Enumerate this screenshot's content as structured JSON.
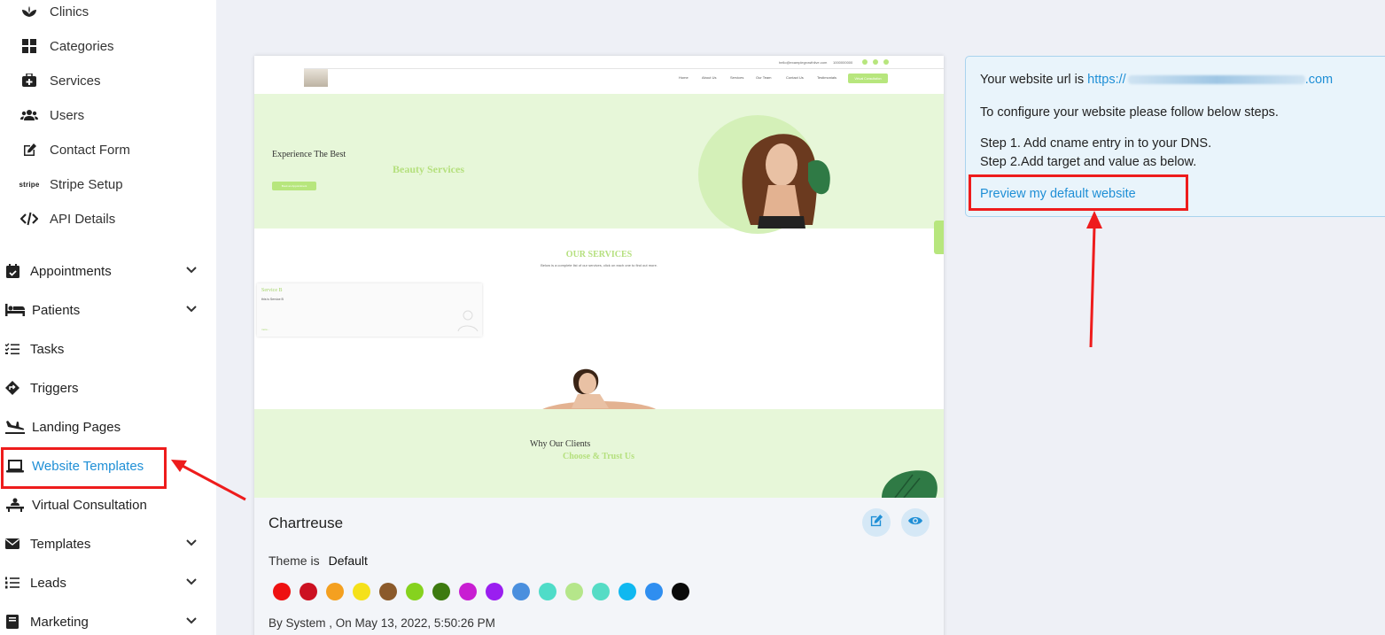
{
  "sidebar": {
    "sub_items": [
      {
        "label": "Clinics",
        "icon": "leaf-icon"
      },
      {
        "label": "Categories",
        "icon": "grid-icon"
      },
      {
        "label": "Services",
        "icon": "medkit-icon"
      },
      {
        "label": "Users",
        "icon": "users-icon"
      },
      {
        "label": "Contact Form",
        "icon": "edit-icon"
      },
      {
        "label": "Stripe Setup",
        "icon": "stripe-icon",
        "icon_text": "stripe"
      },
      {
        "label": "API Details",
        "icon": "code-icon"
      }
    ],
    "main_items": [
      {
        "label": "Appointments",
        "icon": "calendar-check-icon",
        "chevron": true
      },
      {
        "label": "Patients",
        "icon": "bed-icon",
        "chevron": true
      },
      {
        "label": "Tasks",
        "icon": "tasks-icon",
        "chevron": false
      },
      {
        "label": "Triggers",
        "icon": "diamond-arrow-icon",
        "chevron": false
      },
      {
        "label": "Landing Pages",
        "icon": "plane-landing-icon",
        "chevron": false
      },
      {
        "label": "Website Templates",
        "icon": "laptop-icon",
        "chevron": false,
        "active": true
      },
      {
        "label": "Virtual Consultation",
        "icon": "consultation-icon",
        "chevron": false
      },
      {
        "label": "Templates",
        "icon": "envelope-icon",
        "chevron": true
      },
      {
        "label": "Leads",
        "icon": "list-ol-icon",
        "chevron": true
      },
      {
        "label": "Marketing",
        "icon": "book-icon",
        "chevron": true
      }
    ]
  },
  "template_card": {
    "preview": {
      "topbar_email": "hello@examplegrowthlive.com",
      "topbar_phone": "1000000000",
      "nav": [
        "Home",
        "About Us",
        "Services",
        "Our Team",
        "Contact Us",
        "Testimonials"
      ],
      "nav_button": "Virtual Consultation",
      "hero_line1": "Experience The Best",
      "hero_line2": "Beauty Services",
      "hero_button": "Book an Appointment",
      "services_title": "OUR SERVICES",
      "services_subtitle": "Below is a complete list of our services, click on each one to find out more.",
      "service_card_name": "Service B",
      "service_card_desc": "this is Service B",
      "service_card_more": "more...",
      "why_line1": "Why Our Clients",
      "why_line2": "Choose & Trust Us"
    },
    "name": "Chartreuse",
    "theme_label": "Theme is",
    "theme_value": "Default",
    "swatches": [
      "#ee1111",
      "#cc1122",
      "#f4a020",
      "#f5e11a",
      "#8b5a2b",
      "#86d21e",
      "#3d7a10",
      "#c81ed2",
      "#9a1ef0",
      "#4a8fde",
      "#4fdcc8",
      "#b5e68a",
      "#55dcc5",
      "#10b8f0",
      "#2f8ef0",
      "#0a0a0a"
    ],
    "meta": "By System , On May 13, 2022, 5:50:26 PM"
  },
  "info_panel": {
    "url_prefix": "Your website url is",
    "url_visible_start": "https://",
    "url_visible_end": ".com",
    "configure_text": "To configure your website please follow below steps.",
    "step1": "Step 1. Add cname entry in to your DNS.",
    "step2": "Step 2.Add target and value as below.",
    "preview_link": "Preview my default website"
  }
}
